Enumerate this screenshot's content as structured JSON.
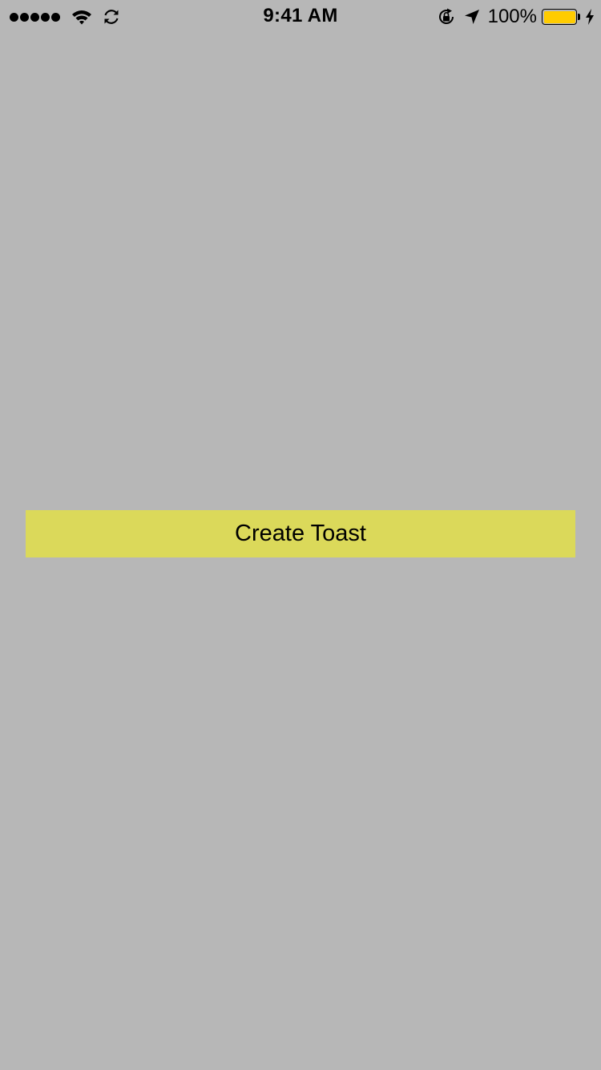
{
  "status_bar": {
    "time": "9:41 AM",
    "battery_percent": "100%",
    "signal_strength": 5,
    "battery_level": 1.0,
    "icons": {
      "signal": "signal-dots-icon",
      "wifi": "wifi-icon",
      "sync": "sync-icon",
      "rotation_lock": "rotation-lock-icon",
      "location": "location-arrow-icon",
      "battery": "battery-icon",
      "charging": "charging-bolt-icon"
    }
  },
  "main": {
    "create_toast_label": "Create Toast"
  },
  "colors": {
    "background": "#b7b7b7",
    "button": "#dbd95a",
    "battery_fill": "#ffcc00",
    "text": "#000000"
  }
}
